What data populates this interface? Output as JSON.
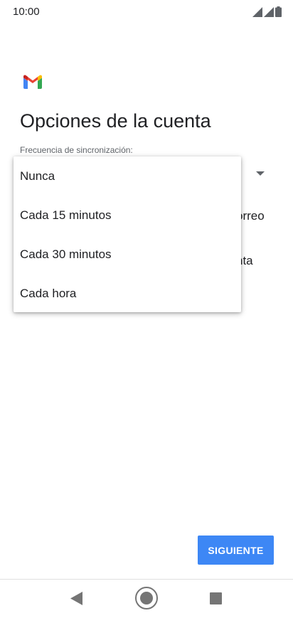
{
  "status_bar": {
    "time": "10:00",
    "icons": [
      "signal-icon",
      "signal-icon",
      "battery-icon"
    ]
  },
  "header": {
    "logo": "gmail-logo",
    "title": "Opciones de la cuenta"
  },
  "sync": {
    "label": "Frecuencia de sincronización:",
    "options": [
      "Nunca",
      "Cada 15 minutos",
      "Cada 30 minutos",
      "Cada hora"
    ]
  },
  "background_partial_text": [
    "orreo",
    "nta"
  ],
  "footer": {
    "next_label": "SIGUIENTE"
  },
  "colors": {
    "accent": "#3d87f5",
    "gmail_red": "#ea4335",
    "gmail_blue": "#4285f4",
    "gmail_green": "#34a853",
    "gmail_yellow": "#fbbc04"
  },
  "nav": {
    "icons": [
      "back-icon",
      "home-icon",
      "recents-icon"
    ]
  }
}
